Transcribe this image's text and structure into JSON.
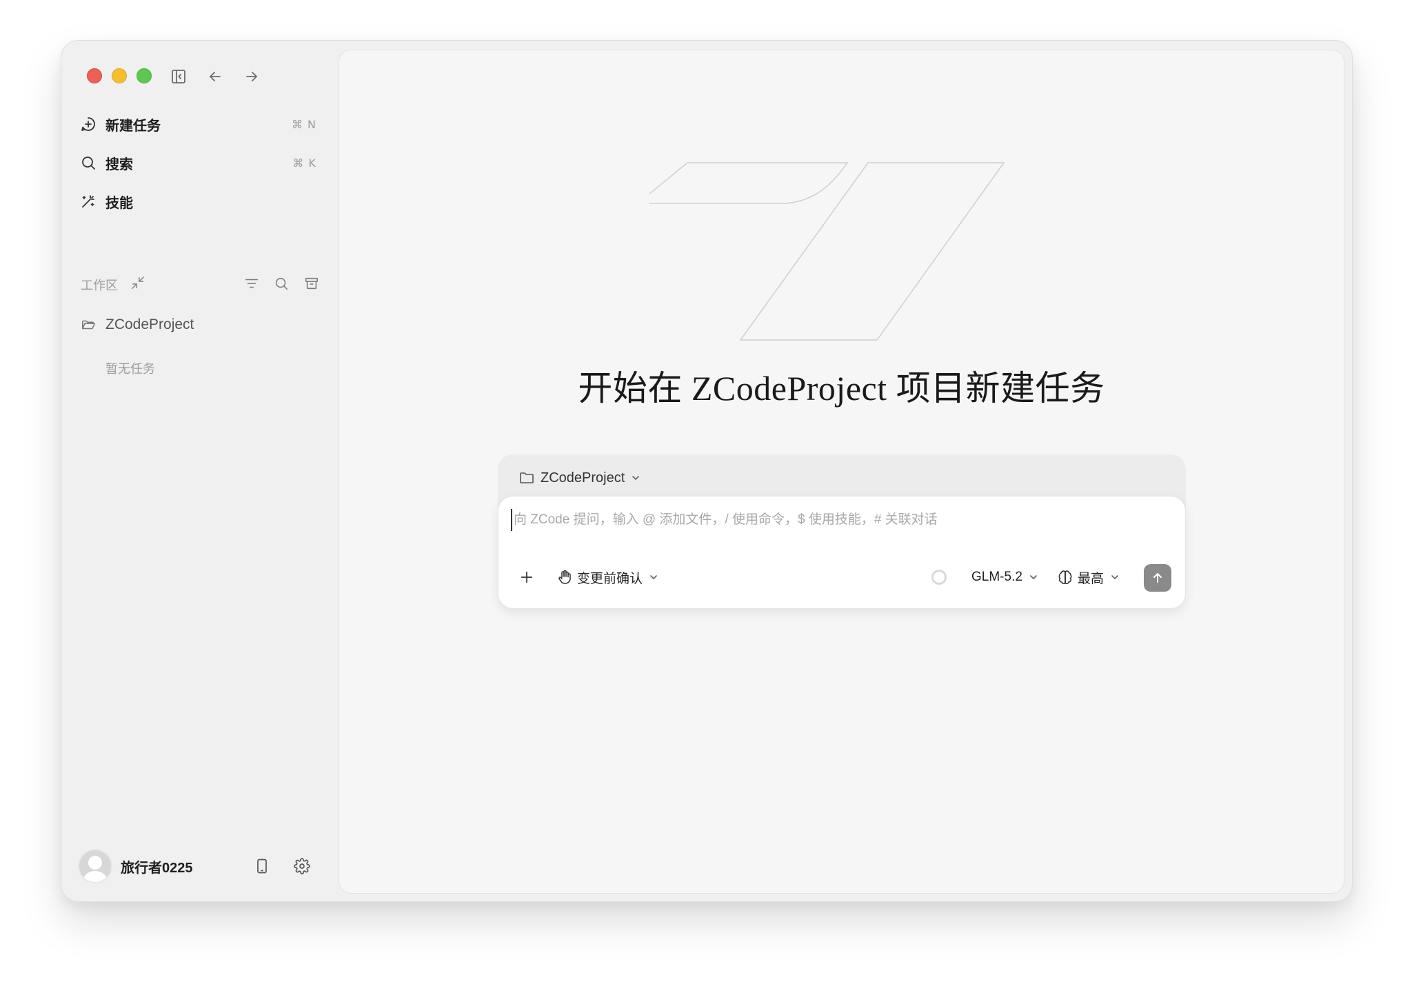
{
  "sidebar": {
    "nav": [
      {
        "label": "新建任务",
        "shortcut": "⌘ N",
        "icon": "plus-circle-icon"
      },
      {
        "label": "搜索",
        "shortcut": "⌘ K",
        "icon": "search-icon"
      },
      {
        "label": "技能",
        "shortcut": "",
        "icon": "magic-wand-icon"
      }
    ],
    "workspace_label": "工作区",
    "project_name": "ZCodeProject",
    "empty_tasks": "暂无任务",
    "user_name": "旅行者0225"
  },
  "main": {
    "hero_title": "开始在 ZCodeProject 项目新建任务",
    "composer": {
      "project": "ZCodeProject",
      "placeholder": "向 ZCode 提问，输入 @ 添加文件，/ 使用命令，$ 使用技能，# 关联对话",
      "mode": "变更前确认",
      "model": "GLM-5.2",
      "reasoning": "最高"
    }
  },
  "colors": {
    "close": "#ed5f57",
    "minimize": "#f5be2f",
    "zoom": "#5dc84f",
    "send_button": "#8a8a8a"
  }
}
